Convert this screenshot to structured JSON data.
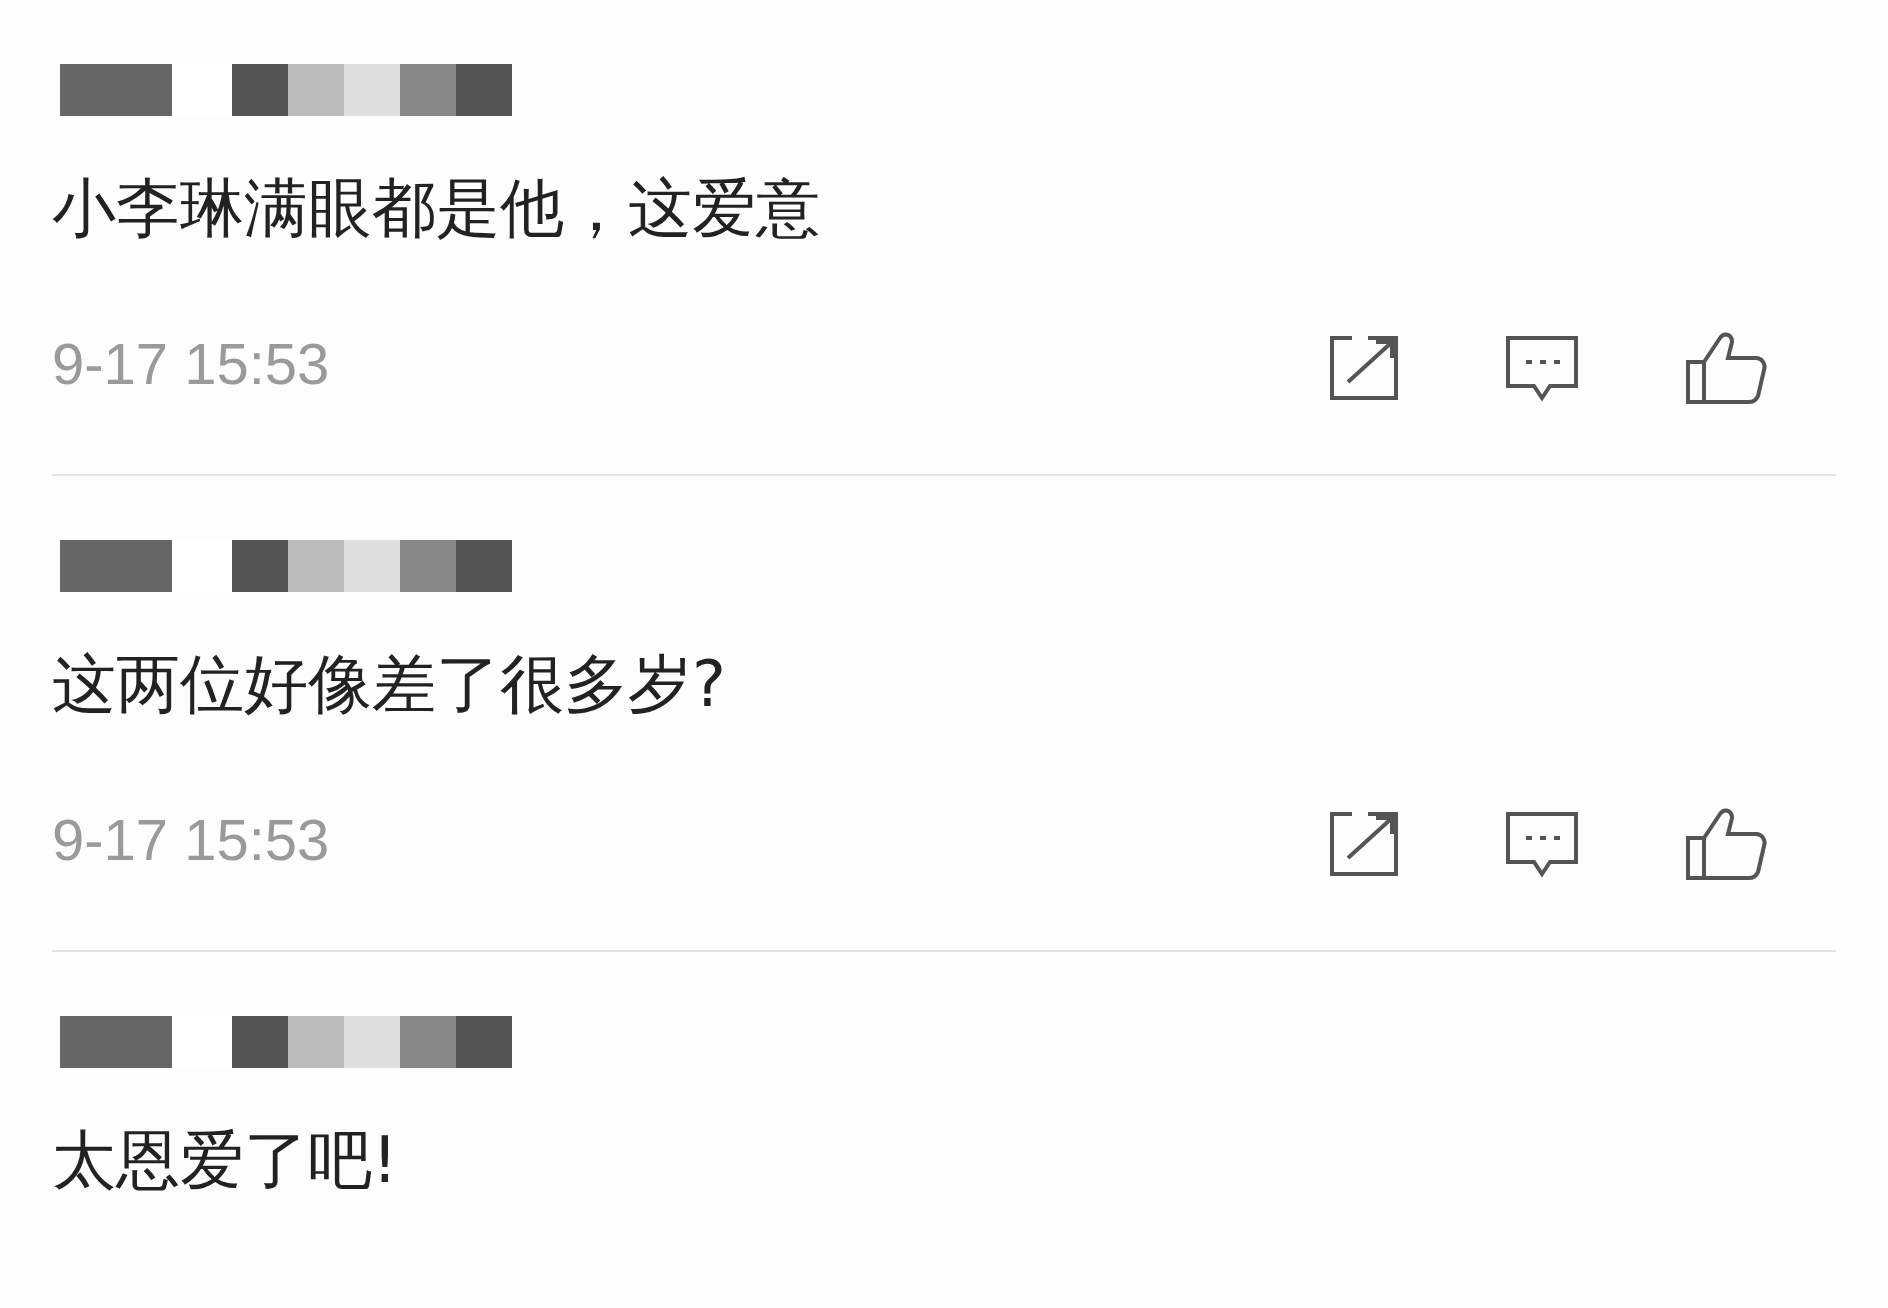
{
  "comments": [
    {
      "text": "小李琳满眼都是他，这爱意",
      "time": "9-17 15:53"
    },
    {
      "text": "这两位好像差了很多岁?",
      "time": "9-17 15:53"
    },
    {
      "text": "太恩爱了吧!"
    }
  ]
}
